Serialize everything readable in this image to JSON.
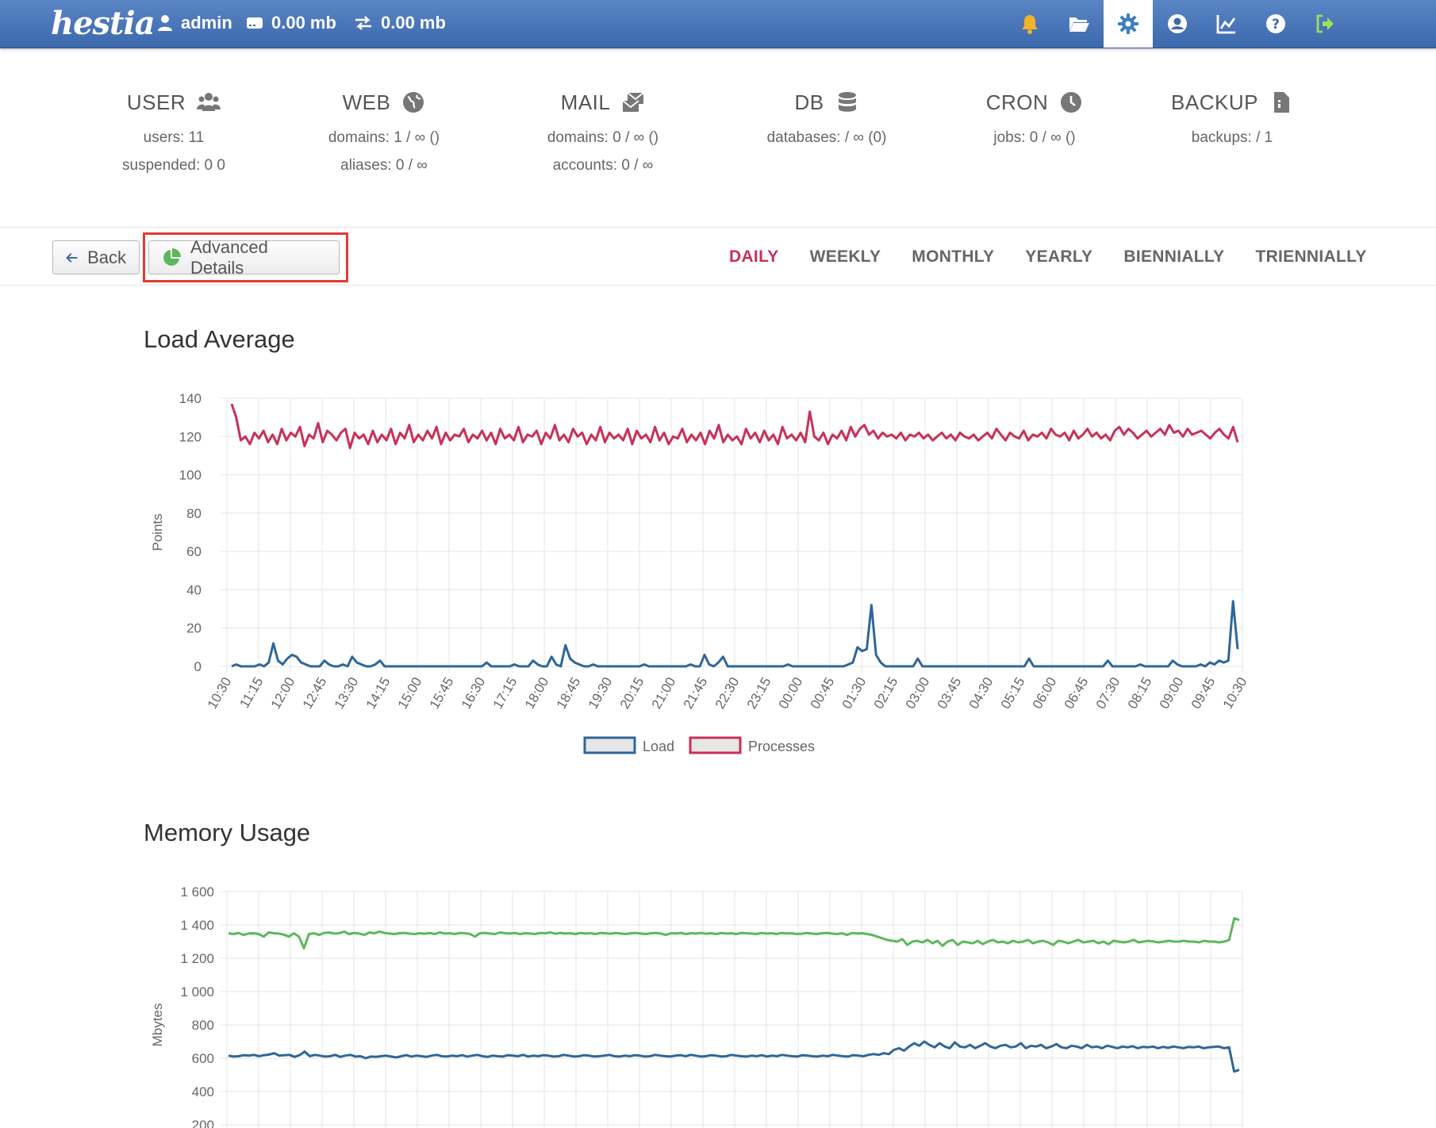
{
  "header": {
    "logo": "hestia",
    "user": "admin",
    "disk": "0.00 mb",
    "bandwidth": "0.00 mb",
    "icons": [
      "bell-icon",
      "folder-icon",
      "gear-icon",
      "user-circle-icon",
      "chart-icon",
      "help-icon",
      "logout-icon"
    ],
    "active_icon": "gear-icon"
  },
  "stats": [
    {
      "title": "USER",
      "icon": "users-icon",
      "lines": [
        "users: 11",
        "suspended: 0 0"
      ]
    },
    {
      "title": "WEB",
      "icon": "globe-icon",
      "lines": [
        "domains: 1 / ∞ ()",
        "aliases: 0 / ∞"
      ]
    },
    {
      "title": "MAIL",
      "icon": "mail-icon",
      "lines": [
        "domains: 0 / ∞ ()",
        "accounts: 0 / ∞"
      ]
    },
    {
      "title": "DB",
      "icon": "database-icon",
      "lines": [
        "databases: / ∞ (0)"
      ]
    },
    {
      "title": "CRON",
      "icon": "clock-icon",
      "lines": [
        "jobs: 0 / ∞ ()"
      ]
    },
    {
      "title": "BACKUP",
      "icon": "file-icon",
      "lines": [
        "backups: / 1"
      ]
    }
  ],
  "toolbar": {
    "back_label": "Back",
    "advanced_label": "Advanced Details",
    "periods": [
      "DAILY",
      "WEEKLY",
      "MONTHLY",
      "YEARLY",
      "BIENNIALLY",
      "TRIENNIALLY"
    ],
    "active_period": "DAILY"
  },
  "colors": {
    "load": "#2f6797",
    "processes": "#c7315a",
    "memory_used": "#5cb85c",
    "memory_other": "#2f6797",
    "accent": "#c7315a"
  },
  "chart_data": [
    {
      "type": "line",
      "title": "Load Average",
      "ylabel": "Points",
      "ylim": [
        0,
        140
      ],
      "yticks": [
        0,
        20,
        40,
        60,
        80,
        100,
        120,
        140
      ],
      "xticks": [
        "10:30",
        "11:15",
        "12:00",
        "12:45",
        "13:30",
        "14:15",
        "15:00",
        "15:45",
        "16:30",
        "17:15",
        "18:00",
        "18:45",
        "19:30",
        "20:15",
        "21:00",
        "21:45",
        "22:30",
        "23:15",
        "00:00",
        "00:45",
        "01:30",
        "02:15",
        "03:00",
        "03:45",
        "04:30",
        "05:15",
        "06:00",
        "06:45",
        "07:30",
        "08:15",
        "09:00",
        "09:45",
        "10:30"
      ],
      "legend": [
        "Load",
        "Processes"
      ],
      "series": [
        {
          "name": "Load",
          "values": [
            0,
            1,
            0,
            0,
            0,
            0,
            1,
            0,
            2,
            12,
            3,
            1,
            4,
            6,
            5,
            2,
            1,
            0,
            0,
            0,
            3,
            1,
            0,
            0,
            1,
            0,
            5,
            2,
            1,
            0,
            0,
            1,
            3,
            0,
            0,
            0,
            0,
            0,
            0,
            0,
            0,
            0,
            0,
            0,
            0,
            0,
            0,
            0,
            0,
            0,
            0,
            0,
            0,
            0,
            0,
            2,
            0,
            0,
            0,
            0,
            0,
            1,
            0,
            0,
            0,
            3,
            1,
            0,
            0,
            5,
            1,
            0,
            11,
            4,
            2,
            1,
            0,
            0,
            1,
            0,
            0,
            0,
            0,
            0,
            0,
            0,
            0,
            0,
            0,
            1,
            0,
            0,
            0,
            0,
            0,
            0,
            0,
            0,
            0,
            1,
            0,
            0,
            6,
            1,
            0,
            2,
            5,
            0,
            0,
            0,
            0,
            0,
            0,
            0,
            0,
            0,
            0,
            0,
            0,
            0,
            1,
            0,
            0,
            0,
            0,
            0,
            0,
            0,
            0,
            0,
            0,
            0,
            0,
            1,
            2,
            10,
            8,
            9,
            32,
            6,
            2,
            0,
            0,
            0,
            0,
            0,
            0,
            0,
            4,
            0,
            0,
            0,
            0,
            0,
            0,
            0,
            0,
            0,
            0,
            0,
            0,
            0,
            0,
            0,
            0,
            0,
            0,
            0,
            0,
            0,
            0,
            0,
            4,
            0,
            0,
            0,
            0,
            0,
            0,
            0,
            0,
            0,
            0,
            0,
            0,
            0,
            0,
            0,
            0,
            3,
            0,
            0,
            0,
            0,
            0,
            0,
            1,
            0,
            0,
            0,
            0,
            0,
            0,
            3,
            1,
            0,
            0,
            0,
            0,
            1,
            0,
            2,
            1,
            3,
            2,
            3,
            34,
            9
          ]
        },
        {
          "name": "Processes",
          "values": [
            137,
            130,
            118,
            120,
            116,
            122,
            119,
            123,
            117,
            121,
            116,
            124,
            118,
            122,
            120,
            125,
            115,
            121,
            119,
            127,
            117,
            123,
            121,
            118,
            122,
            124,
            114,
            122,
            119,
            121,
            116,
            123,
            117,
            121,
            118,
            124,
            116,
            122,
            119,
            126,
            117,
            121,
            118,
            123,
            119,
            125,
            116,
            122,
            118,
            121,
            120,
            124,
            117,
            121,
            119,
            123,
            118,
            122,
            116,
            124,
            119,
            121,
            118,
            125,
            117,
            121,
            120,
            123,
            116,
            122,
            119,
            126,
            118,
            121,
            117,
            124,
            120,
            122,
            116,
            121,
            118,
            125,
            117,
            122,
            119,
            121,
            118,
            124,
            116,
            123,
            119,
            121,
            117,
            125,
            118,
            122,
            116,
            120,
            119,
            124,
            117,
            121,
            118,
            122,
            116,
            123,
            119,
            126,
            117,
            121,
            118,
            120,
            116,
            124,
            119,
            122,
            117,
            123,
            118,
            121,
            116,
            125,
            119,
            121,
            118,
            122,
            117,
            133,
            120,
            118,
            122,
            116,
            121,
            119,
            123,
            118,
            125,
            120,
            124,
            126,
            121,
            123,
            119,
            122,
            120,
            121,
            119,
            122,
            118,
            121,
            120,
            122,
            119,
            121,
            118,
            120,
            122,
            119,
            121,
            118,
            122,
            120,
            119,
            121,
            118,
            120,
            122,
            119,
            124,
            121,
            118,
            122,
            120,
            119,
            123,
            118,
            121,
            120,
            122,
            119,
            124,
            121,
            120,
            122,
            118,
            123,
            119,
            121,
            124,
            120,
            122,
            119,
            121,
            118,
            123,
            125,
            121,
            124,
            122,
            119,
            121,
            123,
            120,
            122,
            124,
            121,
            126,
            122,
            123,
            120,
            124,
            121,
            122,
            123,
            121,
            119,
            122,
            124,
            121,
            119,
            125,
            117
          ]
        }
      ]
    },
    {
      "type": "line",
      "title": "Memory Usage",
      "ylabel": "Mbytes",
      "ylim": [
        200,
        1600
      ],
      "yticks": [
        "1 600",
        "1 400",
        "1 200",
        "1 000",
        "800",
        "600",
        "400",
        "200"
      ],
      "series": [
        {
          "name": "",
          "values": [
            1350,
            1345,
            1352,
            1340,
            1348,
            1350,
            1345,
            1330,
            1355,
            1350,
            1348,
            1342,
            1330,
            1350,
            1330,
            1260,
            1345,
            1350,
            1340,
            1352,
            1355,
            1348,
            1350,
            1360,
            1345,
            1352,
            1348,
            1340,
            1355,
            1350,
            1360,
            1352,
            1348,
            1345,
            1350,
            1352,
            1348,
            1345,
            1350,
            1347,
            1352,
            1345,
            1355,
            1348,
            1350,
            1345,
            1352,
            1350,
            1346,
            1330,
            1350,
            1352,
            1348,
            1345,
            1355,
            1350,
            1348,
            1352,
            1345,
            1350,
            1348,
            1345,
            1352,
            1350,
            1355,
            1347,
            1352,
            1348,
            1350,
            1345,
            1352,
            1348,
            1350,
            1345,
            1352,
            1350,
            1347,
            1352,
            1348,
            1345,
            1350,
            1352,
            1348,
            1345,
            1350,
            1352,
            1348,
            1340,
            1350,
            1348,
            1352,
            1345,
            1350,
            1348,
            1352,
            1347,
            1350,
            1345,
            1352,
            1348,
            1350,
            1345,
            1352,
            1350,
            1348,
            1345,
            1352,
            1348,
            1350,
            1345,
            1352,
            1348,
            1350,
            1345,
            1347,
            1352,
            1348,
            1345,
            1350,
            1352,
            1348,
            1345,
            1350,
            1340,
            1352,
            1348,
            1350,
            1345,
            1340,
            1330,
            1320,
            1310,
            1305,
            1300,
            1315,
            1280,
            1300,
            1305,
            1295,
            1310,
            1290,
            1305,
            1275,
            1300,
            1310,
            1280,
            1300,
            1295,
            1290,
            1305,
            1285,
            1300,
            1310,
            1295,
            1300,
            1290,
            1305,
            1295,
            1300,
            1310,
            1290,
            1300,
            1305,
            1295,
            1280,
            1305,
            1300,
            1290,
            1300,
            1310,
            1295,
            1300,
            1305,
            1290,
            1300,
            1285,
            1305,
            1300,
            1295,
            1300,
            1310,
            1295,
            1300,
            1305,
            1300,
            1295,
            1300,
            1305,
            1300,
            1300,
            1305,
            1300,
            1300,
            1295,
            1305,
            1300,
            1300,
            1295,
            1300,
            1310,
            1440,
            1430
          ]
        },
        {
          "name": "",
          "values": [
            615,
            610,
            612,
            618,
            615,
            620,
            612,
            618,
            622,
            630,
            615,
            618,
            620,
            608,
            618,
            640,
            612,
            620,
            615,
            610,
            612,
            620,
            608,
            615,
            620,
            610,
            612,
            600,
            610,
            608,
            612,
            615,
            610,
            605,
            612,
            618,
            610,
            615,
            612,
            608,
            615,
            620,
            612,
            610,
            615,
            612,
            618,
            610,
            615,
            620,
            612,
            608,
            615,
            612,
            610,
            618,
            615,
            612,
            620,
            610,
            615,
            612,
            618,
            615,
            610,
            612,
            620,
            615,
            610,
            612,
            618,
            615,
            610,
            612,
            615,
            620,
            612,
            610,
            615,
            612,
            618,
            615,
            610,
            612,
            620,
            615,
            612,
            610,
            615,
            618,
            612,
            620,
            615,
            610,
            612,
            618,
            615,
            610,
            612,
            620,
            615,
            612,
            610,
            615,
            612,
            618,
            610,
            615,
            612,
            620,
            615,
            612,
            610,
            618,
            615,
            612,
            610,
            615,
            612,
            620,
            615,
            612,
            610,
            618,
            615,
            612,
            620,
            625,
            620,
            630,
            625,
            650,
            660,
            645,
            670,
            690,
            675,
            700,
            680,
            665,
            690,
            670,
            660,
            695,
            670,
            665,
            680,
            660,
            675,
            690,
            670,
            660,
            675,
            680,
            665,
            670,
            690,
            660,
            675,
            670,
            680,
            660,
            670,
            685,
            665,
            660,
            675,
            670,
            660,
            680,
            665,
            670,
            660,
            675,
            668,
            660,
            670,
            665,
            672,
            660,
            668,
            665,
            670,
            660,
            668,
            662,
            670,
            665,
            660,
            668,
            665,
            670,
            660,
            665,
            668,
            670,
            660,
            665,
            520,
            530
          ]
        }
      ]
    }
  ]
}
